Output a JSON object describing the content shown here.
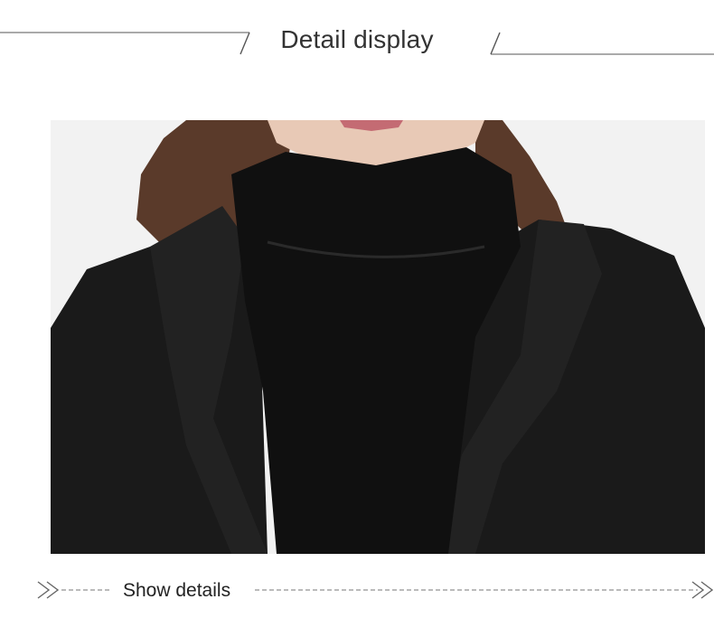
{
  "header": {
    "title": "Detail display"
  },
  "photo": {
    "subject": "model-wearing-black-hooded-coat-over-turtleneck",
    "colors": {
      "background": "#f2f2f2",
      "hair": "#5a3a2a",
      "skin": "#e8c9b6",
      "lips": "#c46b73",
      "turtleneck": "#101010",
      "coat": "#1a1a1a"
    }
  },
  "footer": {
    "label": "Show details"
  }
}
